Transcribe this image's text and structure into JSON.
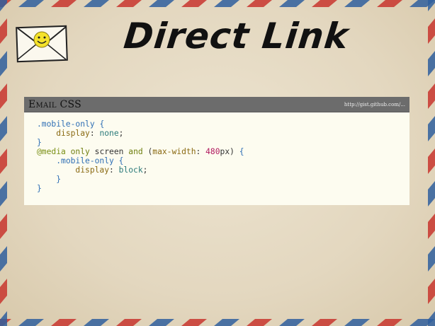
{
  "header": {
    "title": "Direct Link"
  },
  "panel": {
    "title": "Email CSS",
    "link": "http://gist.github.com/..."
  },
  "code": {
    "lines": [
      [
        {
          "t": "sel",
          "v": ".mobile-only"
        },
        {
          "t": "plain",
          "v": " "
        },
        {
          "t": "punc",
          "v": "{"
        }
      ],
      [
        {
          "t": "plain",
          "v": "    "
        },
        {
          "t": "prop",
          "v": "display"
        },
        {
          "t": "plain",
          "v": ": "
        },
        {
          "t": "val",
          "v": "none"
        },
        {
          "t": "plain",
          "v": ";"
        }
      ],
      [
        {
          "t": "punc",
          "v": "}"
        }
      ],
      [
        {
          "t": "at",
          "v": "@media"
        },
        {
          "t": "plain",
          "v": " "
        },
        {
          "t": "kw",
          "v": "only"
        },
        {
          "t": "plain",
          "v": " screen "
        },
        {
          "t": "kw",
          "v": "and"
        },
        {
          "t": "plain",
          "v": " ("
        },
        {
          "t": "prop",
          "v": "max-width"
        },
        {
          "t": "plain",
          "v": ": "
        },
        {
          "t": "num",
          "v": "480"
        },
        {
          "t": "plain",
          "v": "px) "
        },
        {
          "t": "punc",
          "v": "{"
        }
      ],
      [
        {
          "t": "plain",
          "v": "    "
        },
        {
          "t": "sel",
          "v": ".mobile-only"
        },
        {
          "t": "plain",
          "v": " "
        },
        {
          "t": "punc",
          "v": "{"
        }
      ],
      [
        {
          "t": "plain",
          "v": "        "
        },
        {
          "t": "prop",
          "v": "display"
        },
        {
          "t": "plain",
          "v": ": "
        },
        {
          "t": "val",
          "v": "block"
        },
        {
          "t": "plain",
          "v": ";"
        }
      ],
      [
        {
          "t": "plain",
          "v": "    "
        },
        {
          "t": "punc",
          "v": "}"
        }
      ],
      [
        {
          "t": "punc",
          "v": "}"
        }
      ]
    ]
  },
  "colors": {
    "stripe_red": "#c8352e",
    "stripe_blue": "#2f5f9e",
    "paper": "#e6dbc5",
    "panel_header": "#6c6c6c",
    "code_bg": "#fdfcf0"
  },
  "icons": {
    "logo": "envelope-smiley-icon"
  }
}
